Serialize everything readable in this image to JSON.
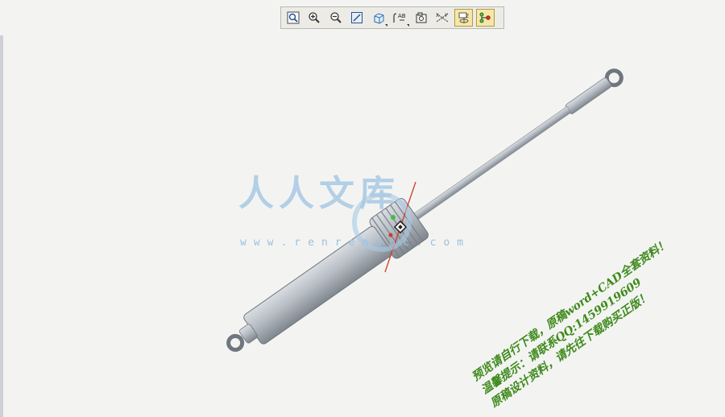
{
  "toolbar": {
    "buttons": [
      {
        "name": "refit-button",
        "icon": "zoom-fit-icon",
        "active": false
      },
      {
        "name": "zoom-in-button",
        "icon": "zoom-in-icon",
        "active": false
      },
      {
        "name": "zoom-out-button",
        "icon": "zoom-out-icon",
        "active": false
      },
      {
        "name": "repaint-button",
        "icon": "repaint-icon",
        "active": false
      },
      {
        "name": "display-style-button",
        "icon": "cube-icon",
        "active": false
      },
      {
        "name": "saved-views-button",
        "icon": "named-views-icon",
        "active": false
      },
      {
        "name": "view-manager-button",
        "icon": "view-manager-icon",
        "active": false
      },
      {
        "name": "datum-display-button",
        "icon": "datum-axes-icon",
        "active": false
      },
      {
        "name": "spin-center-button",
        "icon": "spin-center-icon",
        "active": true
      },
      {
        "name": "mechanism-button",
        "icon": "connection-icon",
        "active": true
      }
    ]
  },
  "watermark": {
    "logo_text": "人人文库",
    "url_text": "www.renrendoc.com",
    "color": "#a9c9e4"
  },
  "promo": {
    "lines": [
      "预览请自行下载，原稿word+CAD全套资料！",
      "温馨提示：请联系QQ:1459919609",
      "原稿设计资料，请先往下载购买正版！"
    ],
    "color": "#3f8a1c"
  },
  "model": {
    "part": "gas-spring-assembly",
    "body_color": "#b6bcc3"
  }
}
